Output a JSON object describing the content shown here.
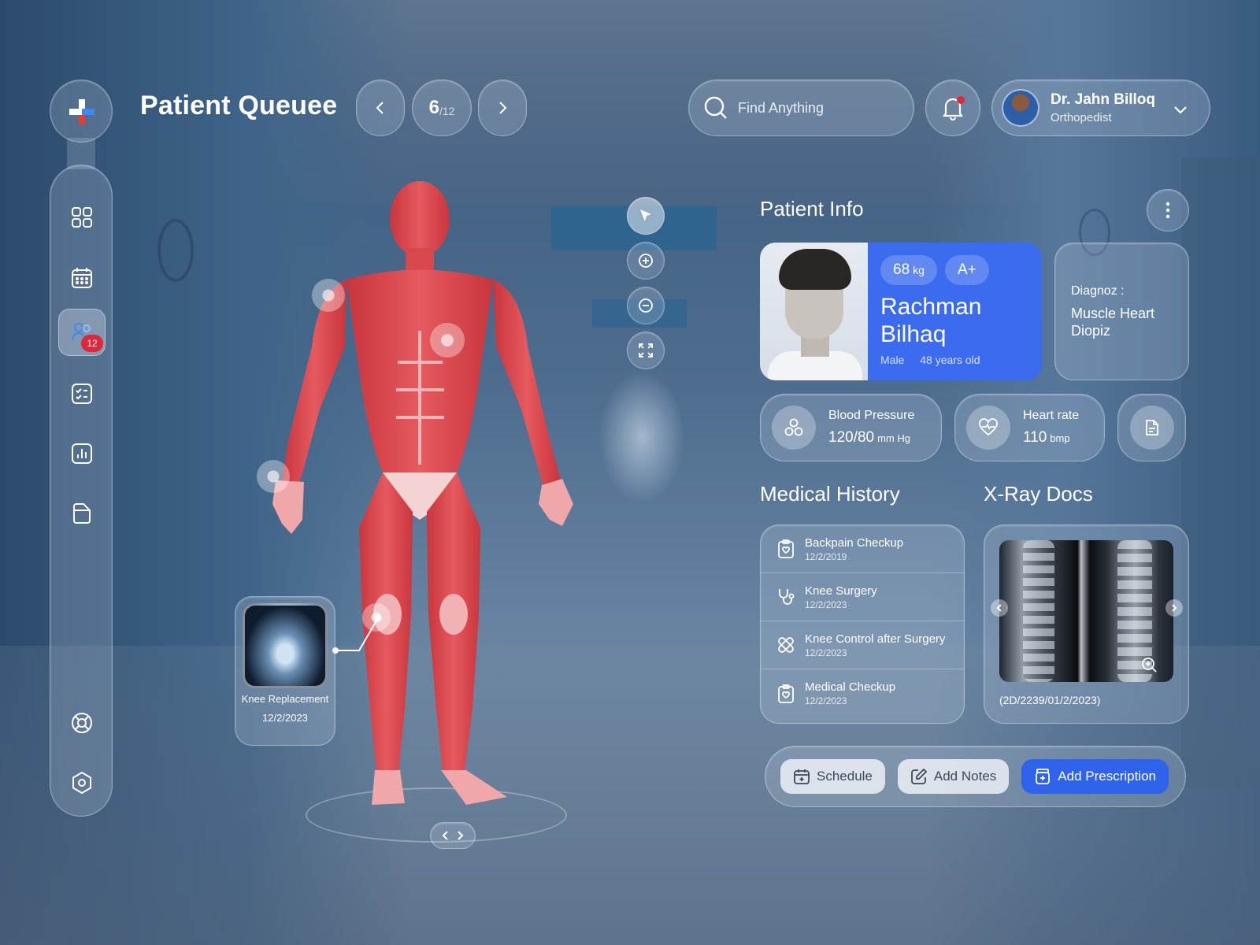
{
  "header": {
    "title": "Patient Queuee",
    "pager": {
      "current": "6",
      "total": "/12"
    },
    "search_placeholder": "Find Anything",
    "user": {
      "name": "Dr. Jahn Billoq",
      "role": "Orthopedist"
    }
  },
  "sidebar": {
    "patients_badge": "12",
    "items": [
      "dashboard",
      "calendar",
      "patients",
      "tasks",
      "reports",
      "documents",
      "support",
      "settings"
    ],
    "active_item": "patients"
  },
  "body_model": {
    "xray_card": {
      "title": "Knee Replacement",
      "date": "12/2/2023"
    }
  },
  "patient_info": {
    "title": "Patient Info",
    "weight": "68",
    "weight_unit": "kg",
    "blood_type": "A+",
    "name": "Rachman Bilhaq",
    "gender": "Male",
    "age": "48 years old",
    "diagnosis_label": "Diagnoz :",
    "diagnosis": "Muscle Heart Diopiz",
    "blood_pressure": {
      "label": "Blood Pressure",
      "value": "120/80",
      "unit": "mm Hg"
    },
    "heart_rate": {
      "label": "Heart rate",
      "value": "110",
      "unit": "bmp"
    }
  },
  "medical_history": {
    "title": "Medical History",
    "items": [
      {
        "title": "Backpain Checkup",
        "date": "12/2/2019",
        "icon": "clipboard-icon"
      },
      {
        "title": "Knee Surgery",
        "date": "12/2/2023",
        "icon": "stethoscope-icon"
      },
      {
        "title": "Knee Control after Surgery",
        "date": "12/2/2023",
        "icon": "bandage-icon"
      },
      {
        "title": "Medical Checkup",
        "date": "12/2/2023",
        "icon": "clipboard-icon"
      }
    ]
  },
  "xray_docs": {
    "title": "X-Ray Docs",
    "caption": "(2D/2239/01/2/2023)"
  },
  "actions": {
    "schedule": "Schedule",
    "add_notes": "Add Notes",
    "add_prescription": "Add Prescription"
  },
  "colors": {
    "primary": "#3b6bef",
    "badge": "#e0263a",
    "logo_red": "#e63b3b",
    "logo_blue": "#3b8bef"
  }
}
